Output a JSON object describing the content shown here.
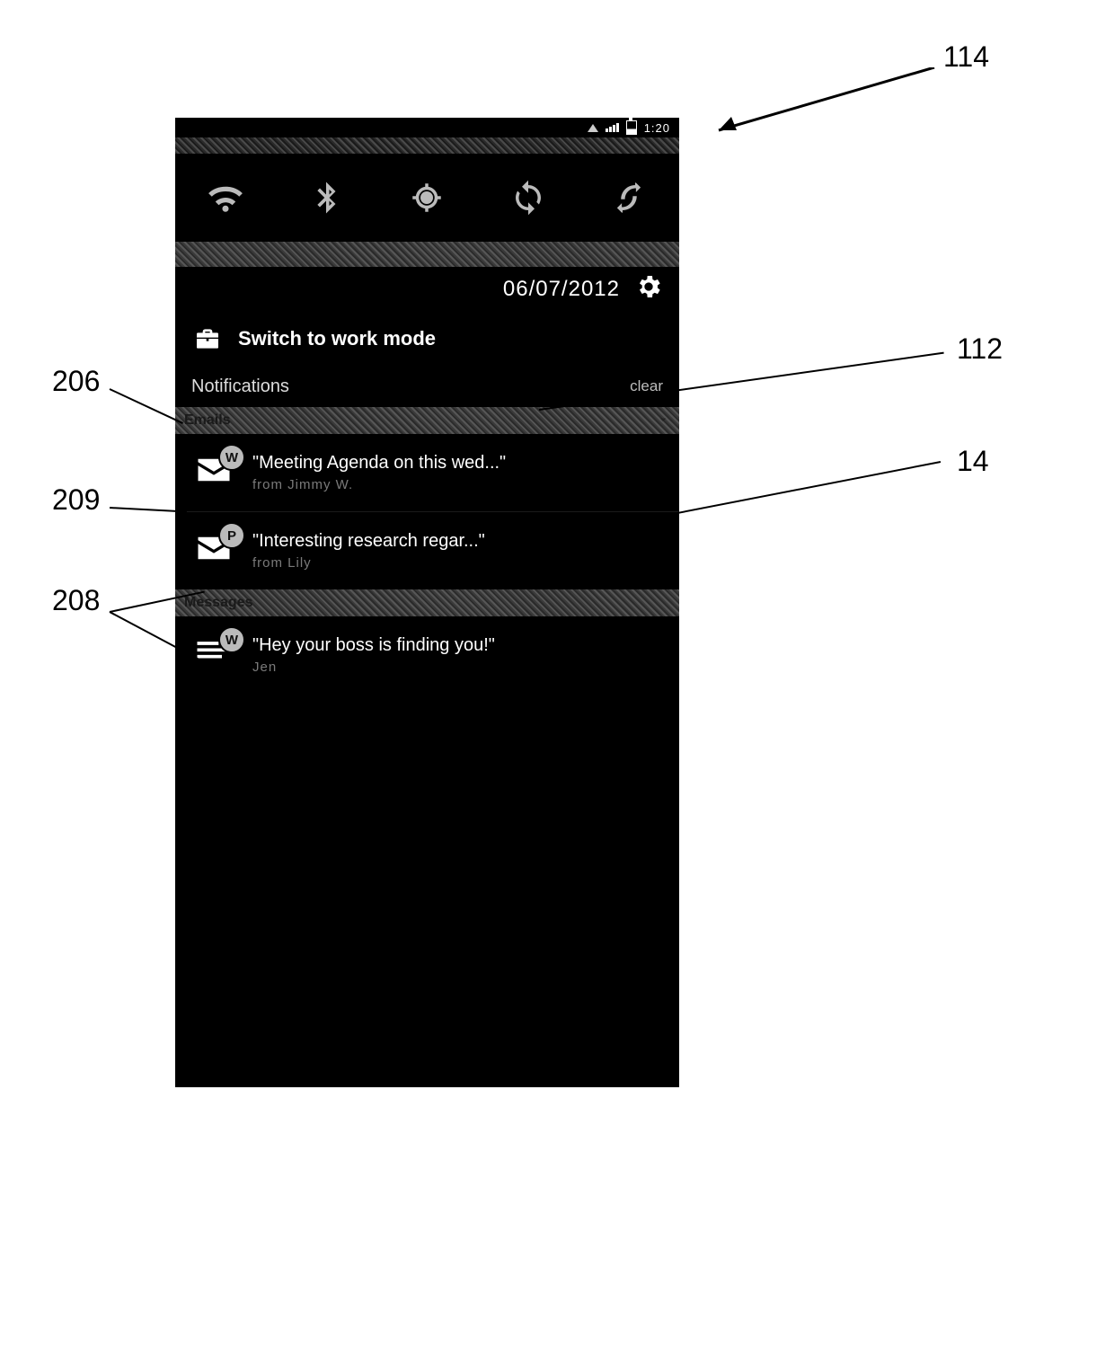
{
  "callouts": {
    "c114": "114",
    "c112": "112",
    "c14": "14",
    "c206": "206",
    "c209": "209",
    "c208": "208"
  },
  "statusbar": {
    "time": "1:20"
  },
  "quick_settings": {
    "items": [
      "wifi",
      "bluetooth",
      "gps",
      "sync",
      "rotation"
    ]
  },
  "date_row": {
    "date": "06/07/2012"
  },
  "switch_mode": {
    "label": "Switch to work mode"
  },
  "notifications": {
    "header": "Notifications",
    "clear_label": "clear",
    "sections": [
      {
        "title": "Emails",
        "items": [
          {
            "badge": "W",
            "title": "\"Meeting Agenda on this wed...\"",
            "sub": "from Jimmy W."
          },
          {
            "badge": "P",
            "title": "\"Interesting research regar...\"",
            "sub": "from Lily"
          }
        ]
      },
      {
        "title": "Messages",
        "items": [
          {
            "badge": "W",
            "title": "\"Hey your boss is finding you!\"",
            "sub": "Jen"
          }
        ]
      }
    ]
  }
}
